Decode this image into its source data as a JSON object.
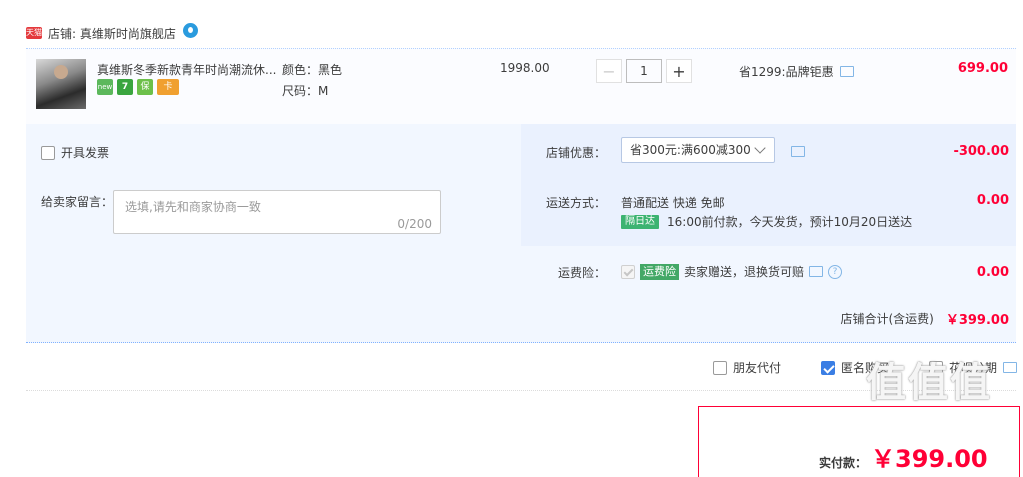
{
  "store": {
    "badge": "天猫",
    "label": "店铺: 真维斯时尚旗舰店"
  },
  "item": {
    "title": "真维斯冬季新款青年时尚潮流休...",
    "tags": [
      {
        "icon": "new-tag-icon",
        "text": "new",
        "color": "#5cb85c"
      },
      {
        "icon": "seven-day-return-icon",
        "text": "7",
        "color": "#4caf50"
      },
      {
        "icon": "guarantee-icon",
        "text": "保",
        "color": "#6cc04a"
      },
      {
        "icon": "card-icon",
        "text": "卡",
        "color": "#f0a030"
      }
    ],
    "color_label": "颜色：黑色",
    "size_label": "尺码：M",
    "unit_price": "1998.00",
    "qty_minus": "−",
    "quantity": "1",
    "qty_plus": "+",
    "discount": "省1299:品牌钜惠",
    "total": "699.00"
  },
  "invoice": {
    "label": "开具发票"
  },
  "store_discount": {
    "label": "店铺优惠：",
    "selected": "省300元:满600减300",
    "amount": "-300.00"
  },
  "message": {
    "label": "给卖家留言：",
    "placeholder": "选填,请先和商家协商一致",
    "counter": "0/200"
  },
  "shipping": {
    "label": "运送方式：",
    "method": "普通配送 快递 免邮",
    "badge": "隔日达",
    "detail": "16:00前付款，今天发货，预计10月20日送达",
    "amount": "0.00"
  },
  "insurance": {
    "label": "运费险：",
    "badge": "运费险",
    "text": "卖家赠送，退换货可赔",
    "amount": "0.00"
  },
  "subtotal": {
    "label": "店铺合计(含运费)",
    "amount": "￥399.00"
  },
  "options": {
    "friend_pay": "朋友代付",
    "anonymous": "匿名购买",
    "installment": "花呗分期"
  },
  "payment": {
    "label": "实付款：",
    "amount": "￥399.00"
  },
  "watermark": "值值值",
  "colors": {
    "accent_red": "#ff0036",
    "accent_blue": "#3a7ee4"
  }
}
